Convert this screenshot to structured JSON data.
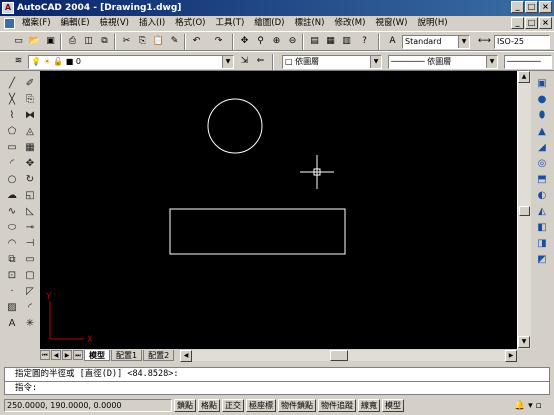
{
  "window": {
    "title": "AutoCAD 2004 - [Drawing1.dwg]",
    "controls": [
      "_",
      "□",
      "×"
    ]
  },
  "menu": [
    "檔案(F)",
    "編輯(E)",
    "檢視(V)",
    "插入(I)",
    "格式(O)",
    "工具(T)",
    "繪圖(D)",
    "標註(N)",
    "修改(M)",
    "視窗(W)",
    "說明(H)"
  ],
  "toolbar": {
    "text_style": "Standard",
    "dim_style": "ISO-25",
    "layer": "0",
    "color": "依圖層",
    "linetype": "依圖層"
  },
  "layout_tabs": [
    "模型",
    "配置1",
    "配置2"
  ],
  "ucs": {
    "y_label": "Y",
    "x_label": "X"
  },
  "command": {
    "line1": "指定圓的半徑或 [直徑(D)] <84.8528>:",
    "line2": "指令:"
  },
  "status": {
    "coords": "250.0000, 190.0000, 0.0000",
    "buttons": [
      "鎖點",
      "格點",
      "正交",
      "極座標",
      "物件鎖點",
      "物件追蹤",
      "線寬",
      "模型"
    ]
  }
}
